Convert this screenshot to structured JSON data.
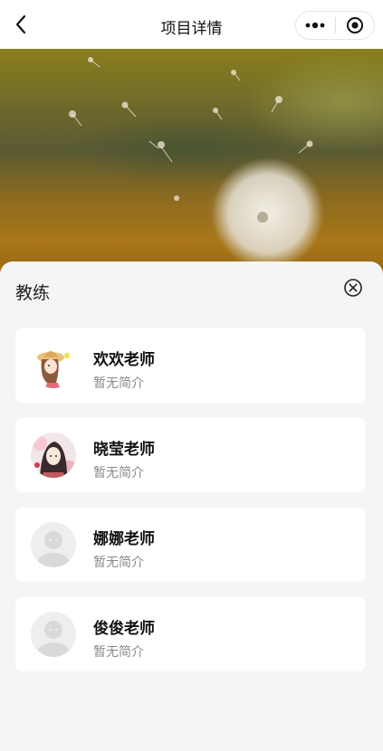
{
  "nav": {
    "title": "项目详情",
    "back_icon": "chevron-left-icon",
    "more_icon": "more-dots-icon",
    "close_icon": "target-circle-icon"
  },
  "hero": {
    "image": "dandelion-photo"
  },
  "sheet": {
    "title": "教练",
    "close_icon": "circle-close-icon"
  },
  "coaches": [
    {
      "name": "欢欢老师",
      "intro": "暂无简介",
      "avatar": "cartoon-girl-hat-avatar"
    },
    {
      "name": "晓莹老师",
      "intro": "暂无简介",
      "avatar": "anime-portrait-avatar"
    },
    {
      "name": "娜娜老师",
      "intro": "暂无简介",
      "avatar": "default-avatar"
    },
    {
      "name": "俊俊老师",
      "intro": "暂无简介",
      "avatar": "default-avatar"
    }
  ],
  "colors": {
    "background": "#f5f5f7",
    "card": "#ffffff",
    "secondary_text": "#8a8a8a"
  }
}
